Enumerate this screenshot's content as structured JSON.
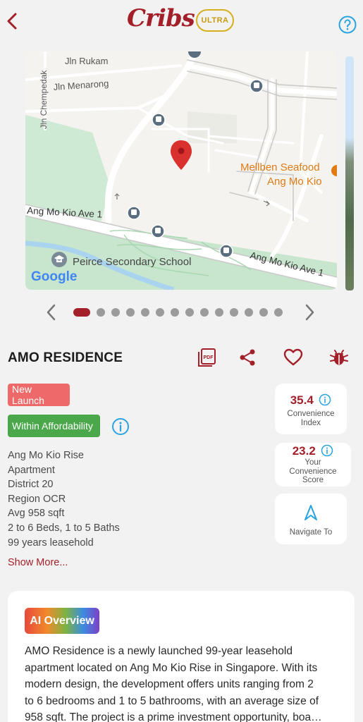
{
  "header": {
    "logo": "Cribs",
    "badge": "ULTRA"
  },
  "map": {
    "labels": {
      "jln_rukam": "Jln Rukam",
      "jln_menarong": "Jln Menarong",
      "jln_chempedak": "Jln Chempedak",
      "mellben_line1": "Mellben Seafood",
      "mellben_line2": "Ang Mo Kio",
      "ave1_left": "Ang Mo Kio Ave 1",
      "ave1_right": "Ang Mo Kio Ave 1",
      "school": "Peirce Secondary School",
      "google": "Google"
    }
  },
  "carousel": {
    "total": 14,
    "active": 0
  },
  "property": {
    "name": "AMO RESIDENCE",
    "tags": {
      "new_launch": "New Launch",
      "affordability": "Within Affordability"
    },
    "details": [
      "Ang Mo Kio Rise",
      "Apartment",
      "District 20",
      "Region OCR",
      "Avg 958 sqft",
      "2 to 6 Beds, 1 to 5 Baths",
      "99 years leasehold"
    ],
    "show_more": "Show More..."
  },
  "cards": {
    "convenience_index": {
      "value": "35.4",
      "label_line1": "Convenience",
      "label_line2": "Index"
    },
    "convenience_score": {
      "value": "23.2",
      "label_line1": "Your",
      "label_line2": "Convenience",
      "label_line3": "Score"
    },
    "navigate": {
      "label": "Navigate To"
    }
  },
  "ai_overview": {
    "badge": "AI Overview",
    "lines": [
      "AMO Residence is a newly launched 99-year leasehold",
      "apartment located on Ang Mo Kio Rise in Singapore. With its",
      "modern design, the development offers units ranging from 2",
      "to 6 bedrooms and 1 to 5 bathrooms, with an average size of",
      "958 sqft. The project is a prime investment opportunity, boa…"
    ]
  },
  "colors": {
    "brand": "#a31f29",
    "ultra_gold": "#d4b01c",
    "info_blue": "#2aa3e0",
    "new_launch": "#ee6a6a",
    "affordability": "#4aa84a",
    "map_marker": "#d9322e",
    "poi_orange": "#e07b14"
  },
  "icons": [
    "back-chevron-icon",
    "help-icon",
    "pdf-icon",
    "share-icon",
    "heart-icon",
    "bug-icon",
    "info-icon",
    "navigate-arrow-icon",
    "bus-stop-icon",
    "school-icon",
    "map-pin-icon"
  ]
}
